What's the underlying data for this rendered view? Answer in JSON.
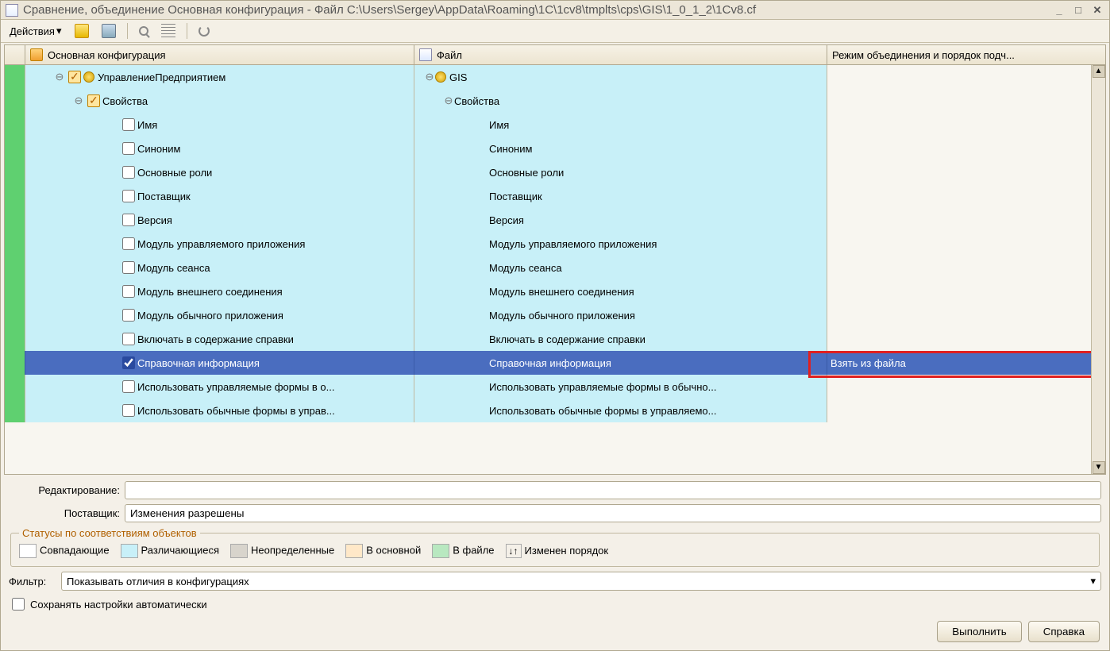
{
  "title": "Сравнение, объединение Основная конфигурация - Файл C:\\Users\\Sergey\\AppData\\Roaming\\1C\\1cv8\\tmplts\\cps\\GIS\\1_0_1_2\\1Cv8.cf",
  "actions_label": "Действия",
  "columns": {
    "main": "Основная конфигурация",
    "file": "Файл",
    "mode": "Режим объединения и порядок подч..."
  },
  "tree": {
    "root_main": "УправлениеПредприятием",
    "root_file": "GIS",
    "props": "Свойства",
    "items": [
      {
        "main": "Имя",
        "file": "Имя",
        "sel": false,
        "stripe": "green",
        "bg": "c",
        "checked": false
      },
      {
        "main": "Синоним",
        "file": "Синоним",
        "sel": false,
        "stripe": "green",
        "bg": "c",
        "checked": false
      },
      {
        "main": "Основные роли",
        "file": "Основные роли",
        "sel": false,
        "stripe": "green",
        "bg": "c",
        "checked": false
      },
      {
        "main": "Поставщик",
        "file": "Поставщик",
        "sel": false,
        "stripe": "green",
        "bg": "c",
        "checked": false
      },
      {
        "main": "Версия",
        "file": "Версия",
        "sel": false,
        "stripe": "green",
        "bg": "c",
        "checked": false
      },
      {
        "main": "Модуль управляемого приложения",
        "file": "Модуль управляемого приложения",
        "sel": false,
        "stripe": "green",
        "bg": "c",
        "checked": false
      },
      {
        "main": "Модуль сеанса",
        "file": "Модуль сеанса",
        "sel": false,
        "stripe": "green",
        "bg": "c",
        "checked": false
      },
      {
        "main": "Модуль внешнего соединения",
        "file": "Модуль внешнего соединения",
        "sel": false,
        "stripe": "green",
        "bg": "c",
        "checked": false
      },
      {
        "main": "Модуль обычного приложения",
        "file": "Модуль обычного приложения",
        "sel": false,
        "stripe": "green",
        "bg": "c",
        "checked": false
      },
      {
        "main": "Включать в содержание справки",
        "file": "Включать в содержание справки",
        "sel": false,
        "stripe": "green",
        "bg": "c",
        "checked": false
      },
      {
        "main": "Справочная информация",
        "file": "Справочная информация",
        "sel": true,
        "stripe": "green",
        "bg": "c",
        "checked": true,
        "mode": "Взять из файла"
      },
      {
        "main": "Использовать управляемые формы в о...",
        "file": "Использовать управляемые формы в обычно...",
        "sel": false,
        "stripe": "green",
        "bg": "c",
        "checked": false
      },
      {
        "main": "Использовать обычные формы в управ...",
        "file": "Использовать обычные формы в управляемо...",
        "sel": false,
        "stripe": "green",
        "bg": "c",
        "checked": false
      }
    ]
  },
  "editing_label": "Редактирование:",
  "editing_value": "",
  "vendor_label": "Поставщик:",
  "vendor_value": "Изменения разрешены",
  "statuses_legend": "Статусы по соответствиям объектов",
  "statuses": {
    "match": "Совпадающие",
    "diff": "Различающиеся",
    "undef": "Неопределенные",
    "main": "В основной",
    "file": "В файле",
    "order": "Изменен порядок"
  },
  "filter_label": "Фильтр:",
  "filter_value": "Показывать отличия в конфигурациях",
  "save_auto": "Сохранять настройки автоматически",
  "buttons": {
    "run": "Выполнить",
    "help": "Справка"
  }
}
